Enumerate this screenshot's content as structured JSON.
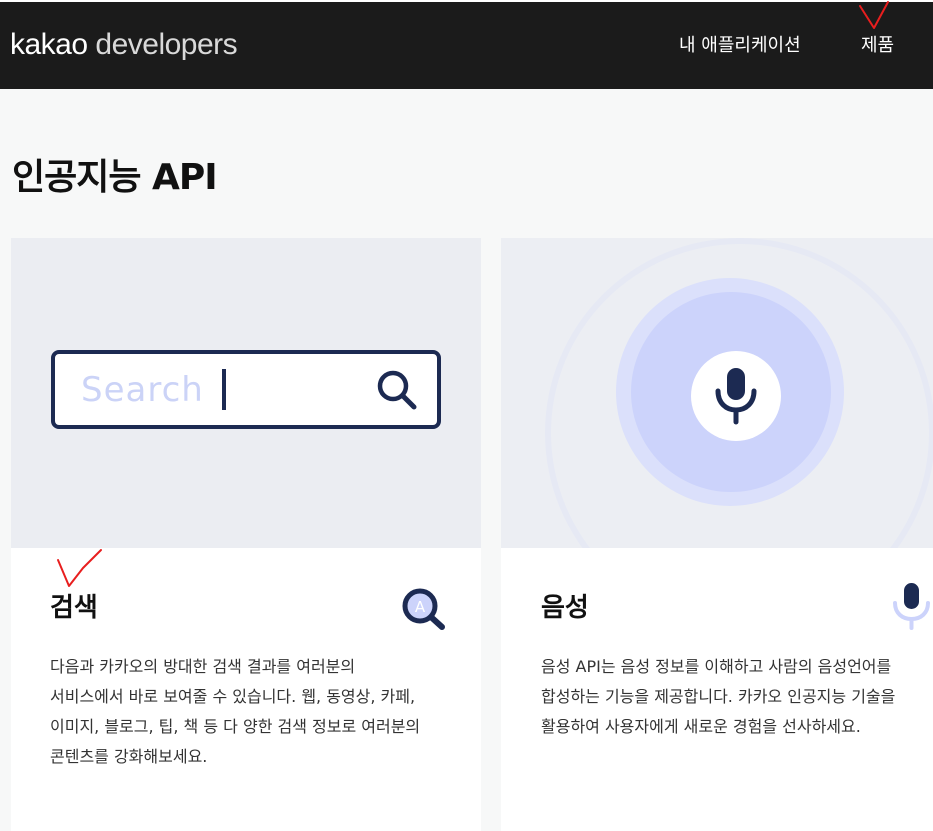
{
  "header": {
    "logo_bold": "kakao",
    "logo_light": "developers",
    "nav": {
      "my_apps": "내 애플리케이션",
      "products": "제품"
    }
  },
  "page": {
    "title": "인공지능 API"
  },
  "cards": [
    {
      "title": "검색",
      "icon": "search-magnifier-icon",
      "thumbnail": {
        "search_placeholder": "Search",
        "icon": "search-icon"
      },
      "description_lines": [
        "다음과 카카오의 방대한 검색 결과를 여러분의",
        "서비스에서 바로 보여줄 수 있습니다. 웹, 동영상, 카페,",
        "이미지, 블로그, 팁, 책 등 다 양한 검색 정보로 여러분의",
        "콘텐츠를 강화해보세요."
      ]
    },
    {
      "title": "음성",
      "icon": "microphone-icon",
      "thumbnail": {
        "icon": "microphone-icon"
      },
      "description_lines": [
        "음성 API는 음성 정보를 이해하고 사람의 음성언어를",
        "합성하는 기능을 제공합니다. 카카오 인공지능 기술을",
        "활용하여 사용자에게 새로운 경험을 선사하세요."
      ]
    }
  ],
  "colors": {
    "header_bg": "#1b1b1b",
    "search_border": "#1c2a52",
    "mic_accent": "#1c2a52",
    "mic_light": "#ccd3fb",
    "annotation_mark": "#ff0000"
  }
}
